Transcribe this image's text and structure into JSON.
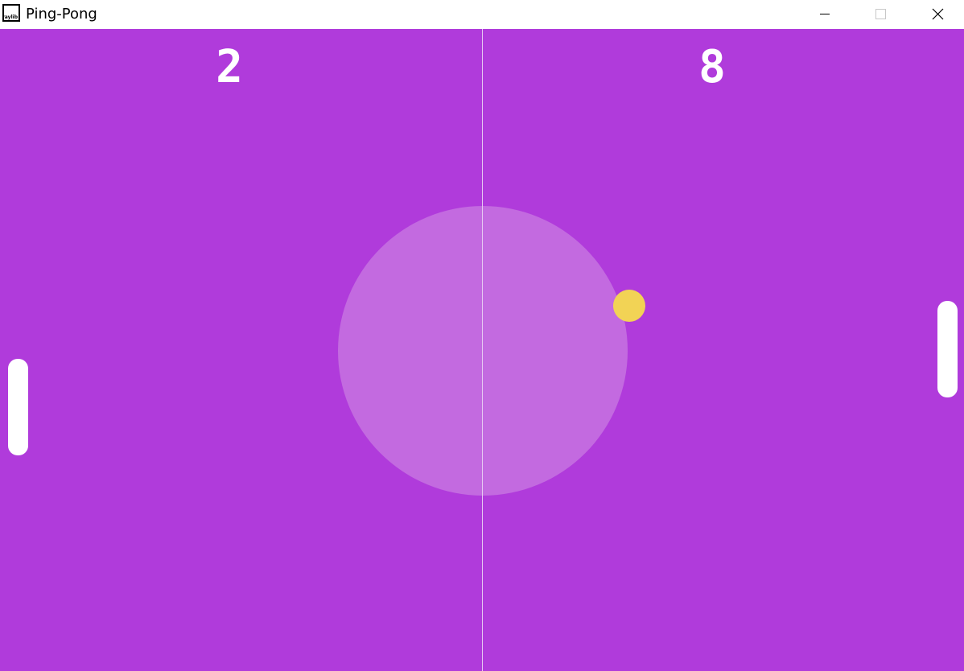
{
  "window": {
    "title": "Ping-Pong",
    "icon_label": "raylib",
    "controls": [
      "minimize-icon",
      "maximize-icon",
      "close-icon"
    ]
  },
  "game": {
    "colors": {
      "background": "#b03bdb",
      "center_circle": "#c36ae0",
      "center_line": "#e6c9f2",
      "ball": "#f2d355",
      "paddle": "#ffffff",
      "score": "#ffffff"
    },
    "scores": {
      "left": "2",
      "right": "8"
    }
  }
}
